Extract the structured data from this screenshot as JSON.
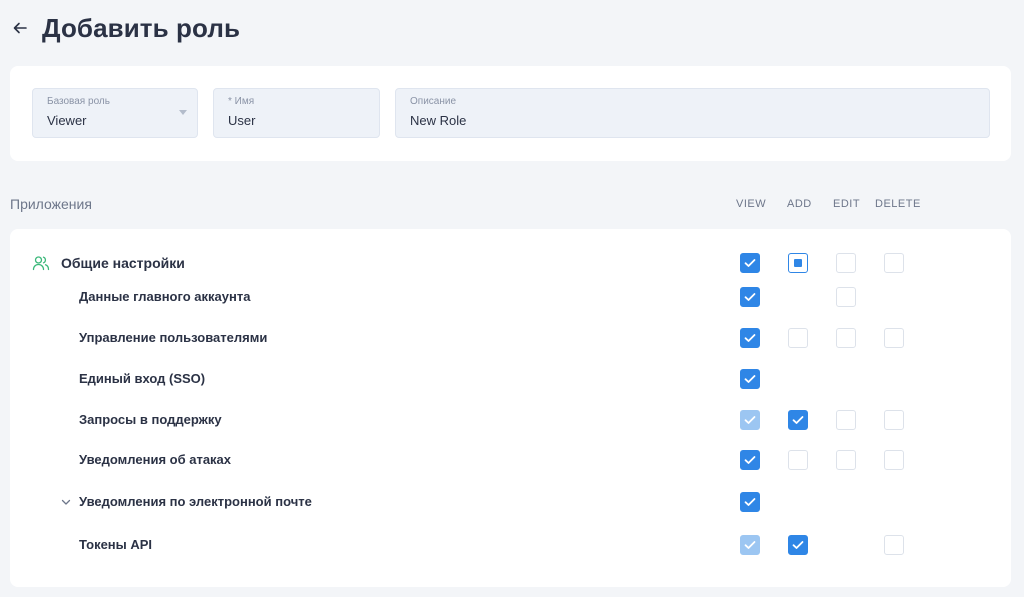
{
  "header": {
    "title": "Добавить роль"
  },
  "fields": {
    "base_role": {
      "label": "Базовая роль",
      "value": "Viewer"
    },
    "name": {
      "label": "* Имя",
      "value": "User"
    },
    "description": {
      "label": "Описание",
      "value": "New Role"
    }
  },
  "permissions": {
    "section_label": "Приложения",
    "columns": [
      "VIEW",
      "ADD",
      "EDIT",
      "DELETE"
    ],
    "group": {
      "label": "Общие настройки",
      "icon": "users-icon",
      "view": "checked",
      "add": "partial",
      "edit": "unchecked",
      "delete": "unchecked"
    },
    "rows": [
      {
        "label": "Данные главного аккаунта",
        "view": "checked",
        "add": "none",
        "edit": "unchecked",
        "delete": "none"
      },
      {
        "label": "Управление пользователями",
        "view": "checked",
        "add": "unchecked",
        "edit": "unchecked",
        "delete": "unchecked"
      },
      {
        "label": "Единый вход (SSO)",
        "view": "checked",
        "add": "none",
        "edit": "none",
        "delete": "none"
      },
      {
        "label": "Запросы в поддержку",
        "view": "checked-disabled",
        "add": "checked",
        "edit": "unchecked",
        "delete": "unchecked"
      },
      {
        "label": "Уведомления об атаках",
        "view": "checked",
        "add": "unchecked",
        "edit": "unchecked",
        "delete": "unchecked"
      },
      {
        "label": "Уведомления по электронной почте",
        "expandable": true,
        "view": "checked",
        "add": "none",
        "edit": "none",
        "delete": "none"
      },
      {
        "label": "Токены API",
        "view": "checked-disabled",
        "add": "checked",
        "edit": "none",
        "delete": "unchecked"
      }
    ]
  },
  "colors": {
    "accent": "#2f86e6",
    "accent_dim": "#9cc6f2",
    "icon_green": "#3bb87a"
  }
}
